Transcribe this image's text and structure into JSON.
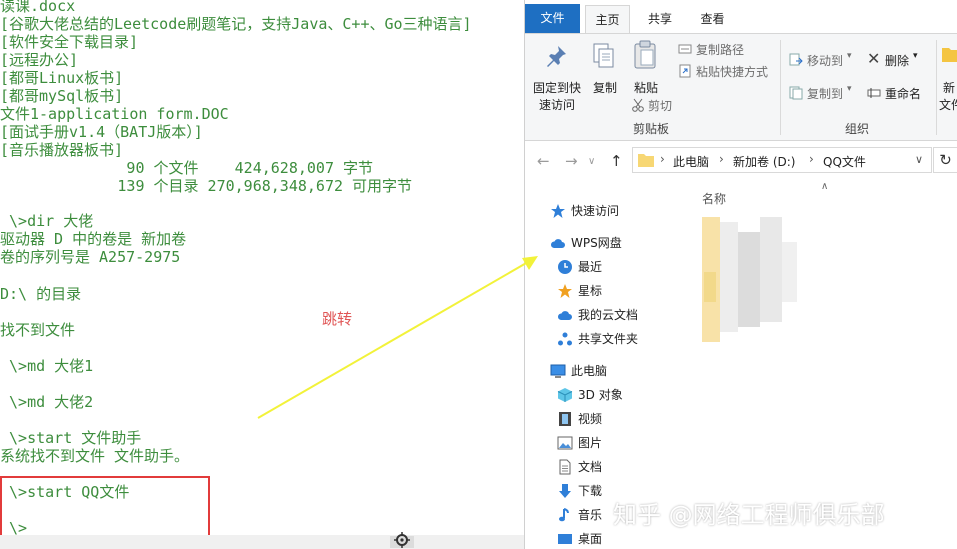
{
  "console": {
    "lines": [
      "读课.docx",
      "[谷歌大佬总结的Leetcode刷题笔记，支持Java、C++、Go三种语言]",
      "[软件安全下载目录]",
      "[远程办公]",
      "[都哥Linux板书]",
      "[都哥mySql板书]",
      "文件1-application form.DOC",
      "[面试手册v1.4（BATJ版本）]",
      "[音乐播放器板书]",
      "              90 个文件    424,628,007 字节",
      "             139 个目录 270,968,348,672 可用字节",
      "",
      " \\>dir 大佬",
      "驱动器 D 中的卷是 新加卷",
      "卷的序列号是 A257-2975",
      "",
      "D:\\ 的目录",
      "",
      "找不到文件",
      "",
      " \\>md 大佬1",
      "",
      " \\>md 大佬2",
      "",
      " \\>start 文件助手",
      "系统找不到文件 文件助手。",
      "",
      " \\>start QQ文件",
      "",
      " \\>"
    ],
    "annotation_label": "跳转"
  },
  "explorer": {
    "tabs": {
      "file": "文件",
      "home": "主页",
      "share": "共享",
      "view": "查看"
    },
    "ribbon": {
      "pin": "固定到快\n速访问",
      "pin_line1": "固定到快",
      "pin_line2": "速访问",
      "copy": "复制",
      "paste": "粘贴",
      "copy_path": "复制路径",
      "paste_shortcut": "粘贴快捷方式",
      "cut": "剪切",
      "clipboard_group": "剪贴板",
      "move_to": "移动到",
      "copy_to": "复制到",
      "delete": "删除",
      "rename": "重命名",
      "organize_group": "组织",
      "new_folder_line1": "新",
      "new_folder_line2": "文件"
    },
    "address": {
      "crumbs": [
        "此电脑",
        "新加卷 (D:)",
        "QQ文件"
      ]
    },
    "nav": {
      "quick_access": "快速访问",
      "wps": "WPS网盘",
      "recent": "最近",
      "starred": "星标",
      "cloud_docs": "我的云文档",
      "shared_folder": "共享文件夹",
      "this_pc": "此电脑",
      "objects3d": "3D 对象",
      "videos": "视频",
      "pictures": "图片",
      "documents": "文档",
      "downloads": "下载",
      "music": "音乐",
      "desktop": "桌面"
    },
    "content": {
      "column_name": "名称"
    }
  },
  "watermark": "知乎 @网络工程师俱乐部",
  "colors": {
    "console_text": "#3d8d3d",
    "highlight": "#e23b3b",
    "arrow": "#f2f23a",
    "file_tab": "#1e6fc2",
    "folder": "#f7d774"
  }
}
